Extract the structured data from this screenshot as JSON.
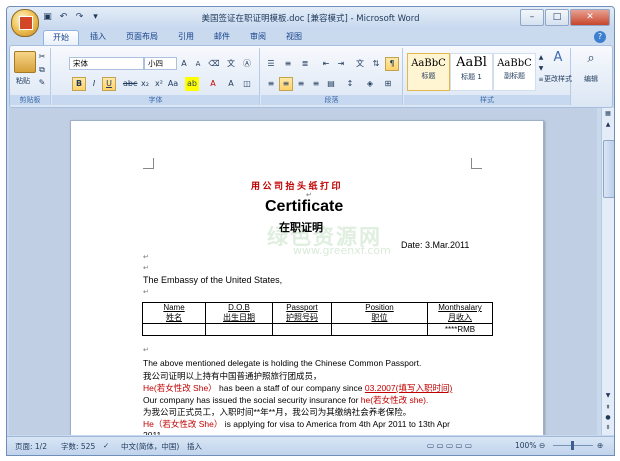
{
  "window": {
    "title": "美国签证在职证明模板.doc [兼容模式] - Microsoft Word",
    "min_label": "–",
    "max_label": "□",
    "close_label": "✕"
  },
  "tabs": [
    "开始",
    "插入",
    "页面布局",
    "引用",
    "邮件",
    "审阅",
    "视图"
  ],
  "ribbon": {
    "clipboard": {
      "paste": "粘贴",
      "group": "剪贴板"
    },
    "font": {
      "name": "宋体",
      "size": "小四",
      "group": "字体"
    },
    "paragraph": {
      "group": "段落"
    },
    "styles": {
      "group": "样式",
      "items": [
        {
          "sample": "AaBbC",
          "label": "标题"
        },
        {
          "sample": "AaBl",
          "label": "标题 1"
        },
        {
          "sample": "AaBbC",
          "label": "副标题"
        }
      ],
      "change": "更改样式"
    },
    "editing": {
      "label": "编辑"
    }
  },
  "document": {
    "letterhead": "用 公 司 抬 头 纸 打 印",
    "title_en": "Certificate",
    "title_cn": "在职证明",
    "date": "Date: 3.Mar.2011",
    "embassy": "The Embassy of the United States,",
    "table": {
      "headers": [
        {
          "en": "Name",
          "cn": "姓名"
        },
        {
          "en": "D.O.B",
          "cn": "出生日期"
        },
        {
          "en": "Passport",
          "cn": "护照号码"
        },
        {
          "en": "Position",
          "cn": "职位"
        },
        {
          "en": "Monthsalary",
          "cn": "月收入"
        }
      ],
      "row": [
        "",
        "",
        "",
        "",
        "****RMB"
      ]
    },
    "lines": {
      "l1": "The above mentioned delegate is holding the Chinese Common Passport.",
      "l2": "我公司证明以上持有中国普通护照旅行团成员，",
      "l3a": "He(若女性改 She）",
      "l3b": " has been a staff of our company since ",
      "l3c": "03.2007(填写入职时间)",
      "l4a": "Our company has issued the social security insurance for ",
      "l4b": "he(若女性改 she).",
      "l5": "为我公司正式员工，入职时间**年**月，我公司为其缴纳社会养老保险。",
      "l6a": "He（若女性改 She）",
      "l6b": "  is applying for visa to America from 4th Apr 2011 to 13th Apr",
      "l7": "2011"
    },
    "para_mark": "↵",
    "watermark": "绿色资源网",
    "watermark_url": "www.greenxf.com"
  },
  "status": {
    "page": "页面: 1/2",
    "words": "字数: 525",
    "language": "中文(简体，中国)",
    "mode": "插入",
    "zoom": "100%",
    "zoom_minus": "⊖",
    "zoom_plus": "⊕"
  }
}
